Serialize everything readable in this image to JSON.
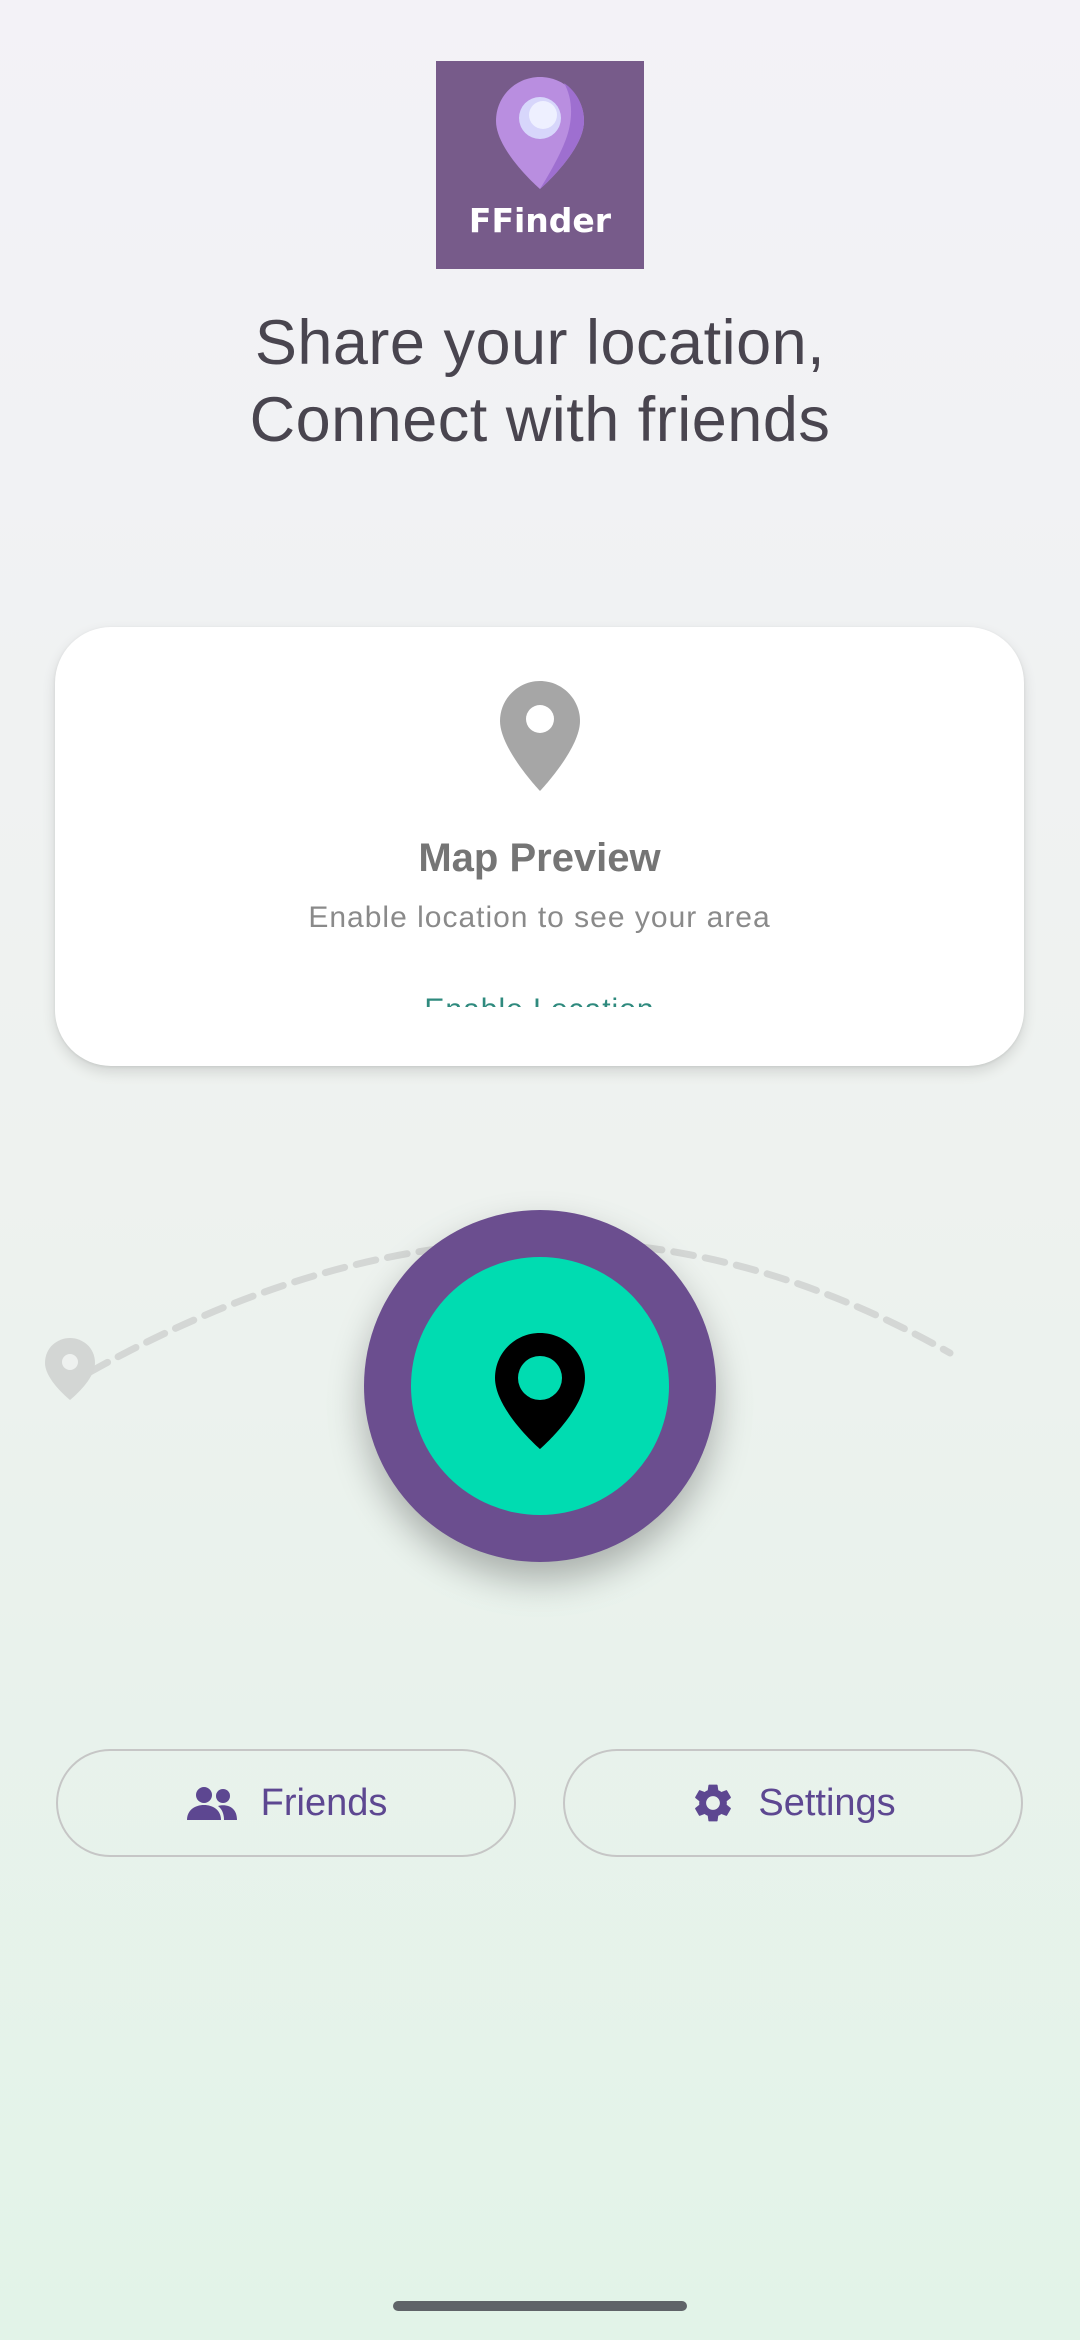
{
  "app": {
    "logo_text": "FFinder",
    "logo_color": "#775b8a"
  },
  "tagline": {
    "line1": "Share your location,",
    "line2": "Connect with friends"
  },
  "map_preview": {
    "icon": "location-pin-icon",
    "title": "Map Preview",
    "subtitle": "Enable location to see your area",
    "action_label": "Enable Location"
  },
  "center_button": {
    "icon": "location-pin-icon",
    "outer_color": "#6b4e8f",
    "inner_color": "#00dcb1"
  },
  "buttons": {
    "friends": {
      "label": "Friends",
      "icon": "people-icon"
    },
    "settings": {
      "label": "Settings",
      "icon": "gear-icon"
    }
  },
  "colors": {
    "accent": "#5d4791",
    "background_top": "#f3f2f7",
    "background_bottom": "#e2f3e8"
  }
}
